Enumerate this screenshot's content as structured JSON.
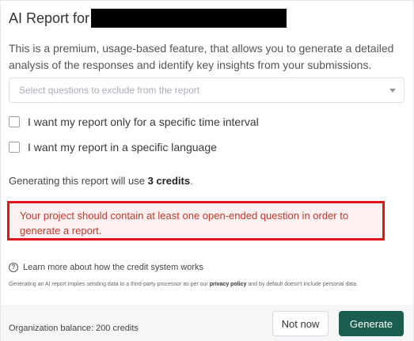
{
  "dialog": {
    "title": "AI Report for",
    "description": "This is a premium, usage-based feature, that allows you to generate a detailed analysis of the responses and identify key insights from your submissions."
  },
  "questions_select": {
    "placeholder": "Select questions to exclude from the report"
  },
  "options": {
    "time_interval_label": "I want my report only for a specific time interval",
    "language_label": "I want my report in a specific language"
  },
  "credits": {
    "prefix": "Generating this report will use ",
    "amount": "3 credits",
    "suffix": "."
  },
  "error": {
    "message": "Your project should contain at least one open-ended question in order to generate a report.",
    "color": "#e0141e"
  },
  "help": {
    "icon": "question-circle-icon",
    "learn_more": "Learn more about how the credit system works"
  },
  "disclaimer": {
    "before_link": "Generating an AI report implies sending data to a third-party processor as per our ",
    "link": "privacy policy",
    "after_link": " and by default doesn't include personal data."
  },
  "footer": {
    "balance": "Organization balance: 200 credits",
    "not_now_label": "Not now",
    "generate_label": "Generate",
    "primary_color": "#1b5e50"
  }
}
